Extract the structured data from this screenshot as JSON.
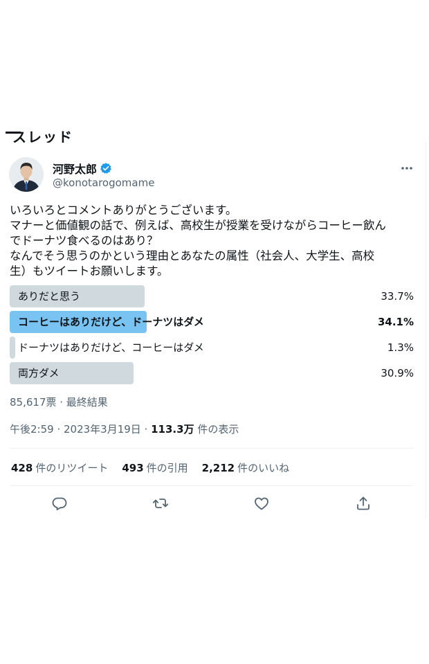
{
  "header_fragment": "スレッド",
  "author": {
    "display_name": "河野太郎",
    "handle": "@konotarogomame",
    "verified": true
  },
  "tweet_text": [
    "いろいろとコメントありがとうございます。",
    "マナーと価値観の話で、例えば、高校生が授業を受けながらコーヒー飲ん",
    "でドーナツ食べるのはあり？",
    "なんでそう思うのかという理由とあなたの属性（社会人、大学生、高校",
    "生）もツイートお願いします。"
  ],
  "poll": {
    "options": [
      {
        "label": "ありだと思う",
        "percent_text": "33.7%",
        "percent": 33.7,
        "winner": false
      },
      {
        "label": "コーヒーはありだけど、ドーナツはダメ",
        "percent_text": "34.1%",
        "percent": 34.1,
        "winner": true
      },
      {
        "label": "ドーナツはありだけど、コーヒーはダメ",
        "percent_text": "1.3%",
        "percent": 1.3,
        "winner": false
      },
      {
        "label": "両方ダメ",
        "percent_text": "30.9%",
        "percent": 30.9,
        "winner": false
      }
    ],
    "votes_text": "85,617票 · 最終結果"
  },
  "timestamp": {
    "time_date": "午後2:59 · 2023年3月19日 · ",
    "views_count": "113.3万",
    "views_label": " 件の表示"
  },
  "stats": {
    "retweets_count": "428",
    "retweets_label": "件のリツイート",
    "quotes_count": "493",
    "quotes_label": "件の引用",
    "likes_count": "2,212",
    "likes_label": "件のいいね"
  },
  "icons": [
    "verified-badge-icon",
    "more-options-icon",
    "reply-icon",
    "retweet-icon",
    "like-icon",
    "share-icon"
  ],
  "colors": {
    "accent": "#1d9bf0",
    "poll_winner": "#79c3f2",
    "poll_bar": "#cfd9de",
    "secondary_text": "#536471",
    "primary_text": "#0f1419"
  }
}
